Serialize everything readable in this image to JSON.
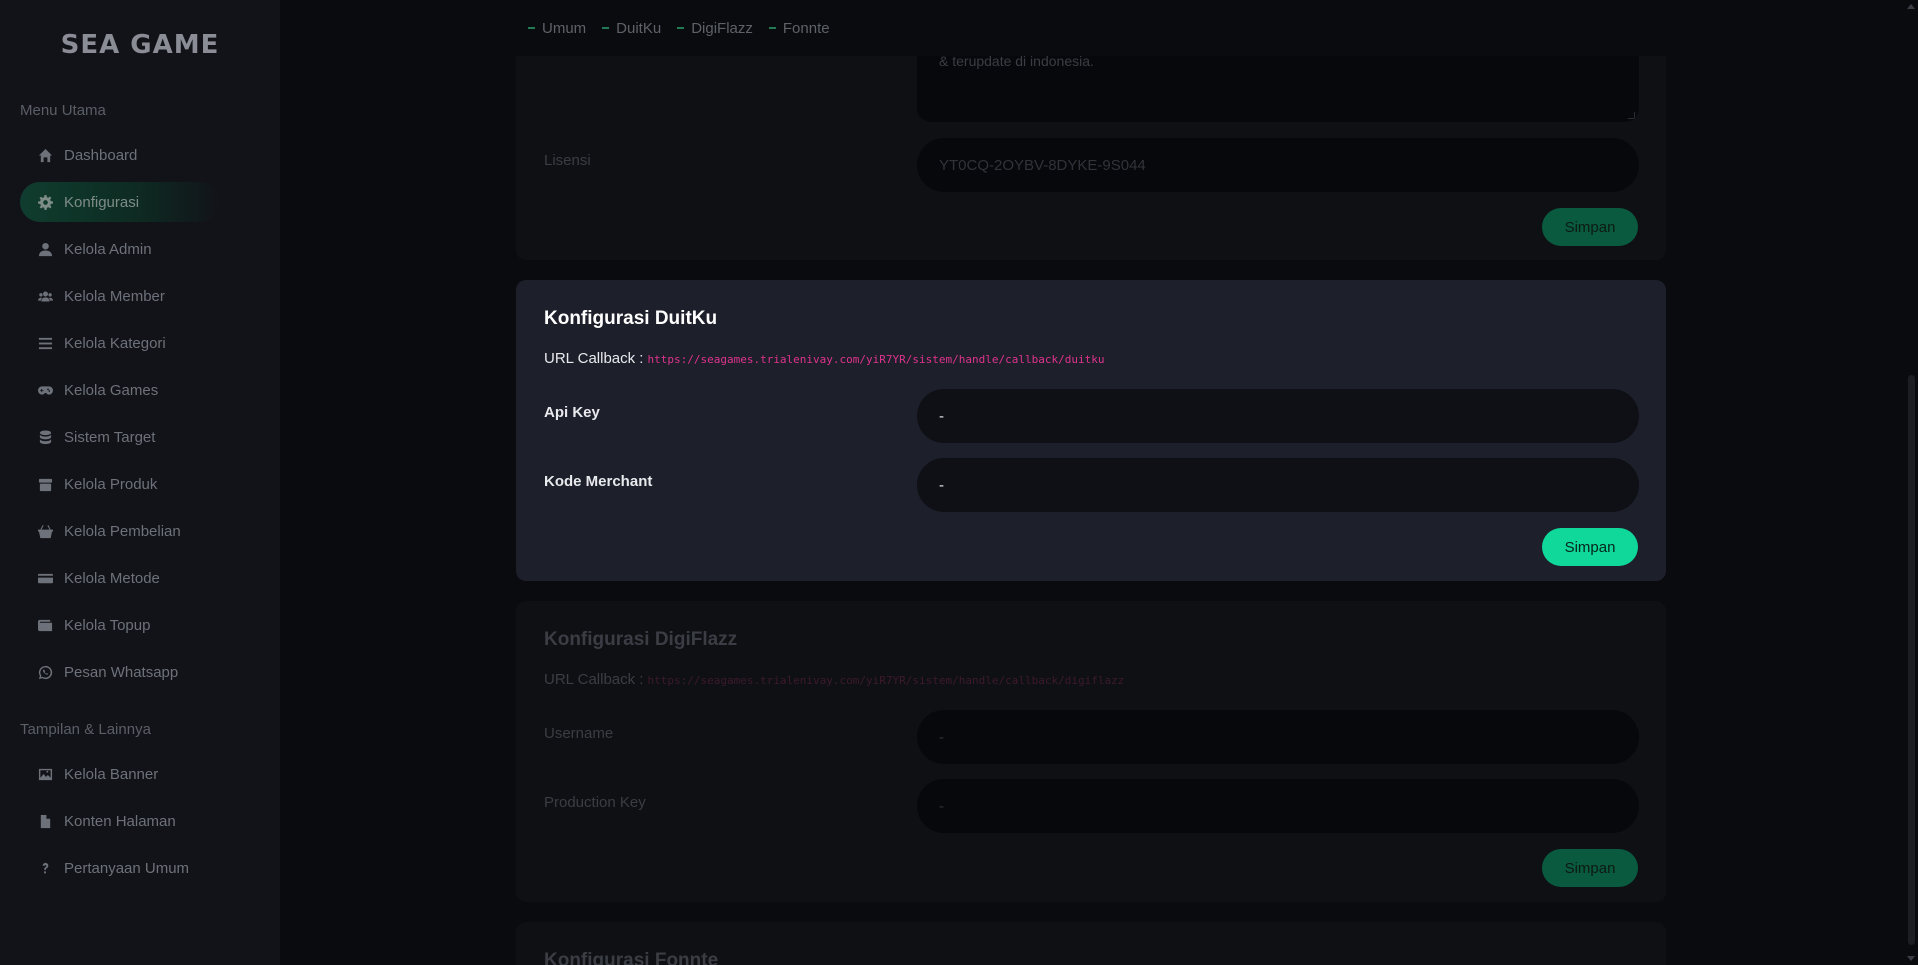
{
  "sidebar": {
    "logo": "SEA GAME",
    "section_main": "Menu Utama",
    "section_other": "Tampilan & Lainnya",
    "items": [
      {
        "label": "Dashboard",
        "icon": "home-icon"
      },
      {
        "label": "Konfigurasi",
        "icon": "gear-icon",
        "active": true
      },
      {
        "label": "Kelola Admin",
        "icon": "user-icon"
      },
      {
        "label": "Kelola Member",
        "icon": "users-icon"
      },
      {
        "label": "Kelola Kategori",
        "icon": "list-icon"
      },
      {
        "label": "Kelola Games",
        "icon": "gamepad-icon"
      },
      {
        "label": "Sistem Target",
        "icon": "database-icon"
      },
      {
        "label": "Kelola Produk",
        "icon": "box-icon"
      },
      {
        "label": "Kelola Pembelian",
        "icon": "basket-icon"
      },
      {
        "label": "Kelola Metode",
        "icon": "credit-card-icon"
      },
      {
        "label": "Kelola Topup",
        "icon": "wallet-icon"
      },
      {
        "label": "Pesan Whatsapp",
        "icon": "whatsapp-icon"
      }
    ],
    "other_items": [
      {
        "label": "Kelola Banner",
        "icon": "image-icon"
      },
      {
        "label": "Konten Halaman",
        "icon": "file-icon"
      },
      {
        "label": "Pertanyaan Umum",
        "icon": "question-icon"
      }
    ]
  },
  "tabs": [
    "Umum",
    "DuitKu",
    "DigiFlazz",
    "Fonnte"
  ],
  "umum": {
    "textarea_partial": "& terupdate di indonesia.",
    "license_label": "Lisensi",
    "license_value": "YT0CQ-2OYBV-8DYKE-9S044",
    "save_label": "Simpan"
  },
  "duitku": {
    "title": "Konfigurasi DuitKu",
    "callback_label": "URL Callback :",
    "callback_url": "https://seagames.trialenivay.com/yiR7YR/sistem/handle/callback/duitku",
    "api_key_label": "Api Key",
    "api_key_value": "-",
    "merchant_label": "Kode Merchant",
    "merchant_value": "-",
    "save_label": "Simpan"
  },
  "digiflazz": {
    "title": "Konfigurasi DigiFlazz",
    "callback_label": "URL Callback :",
    "callback_url": "https://seagames.trialenivay.com/yiR7YR/sistem/handle/callback/digiflazz",
    "username_label": "Username",
    "username_value": "-",
    "production_key_label": "Production Key",
    "production_key_value": "-",
    "save_label": "Simpan"
  },
  "fonnte": {
    "title": "Konfigurasi Fonnte"
  },
  "colors": {
    "accent": "#0fd89a",
    "callback_url": "#e0338e",
    "active_card": "#1d1f2a"
  }
}
